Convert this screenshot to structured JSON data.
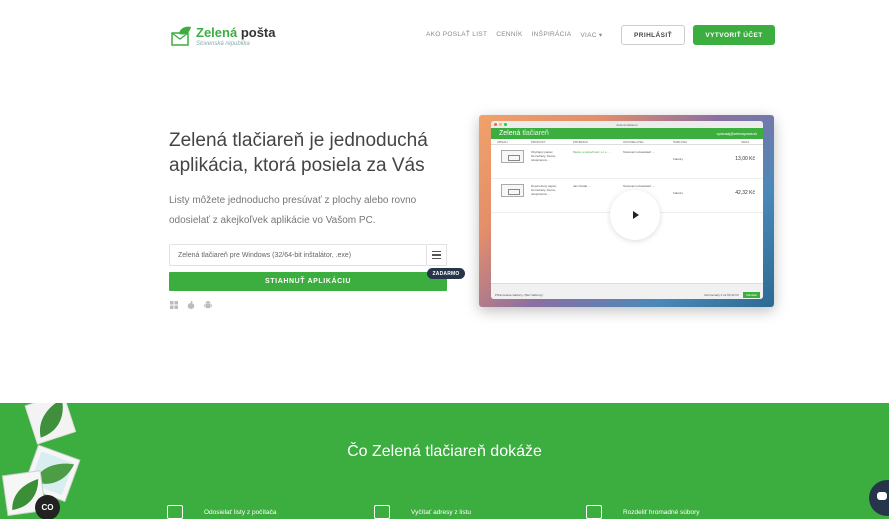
{
  "header": {
    "logo_name_green": "Zelená",
    "logo_name_dark": "pošta",
    "logo_sub": "Slovenská republika",
    "nav": [
      {
        "label": "AKO POSLAŤ LIST"
      },
      {
        "label": "CENNÍK"
      },
      {
        "label": "INŠPIRÁCIA"
      },
      {
        "label": "VIAC ▾"
      }
    ],
    "login_label": "PRIHLÁSIŤ",
    "create_label": "VYTVORIŤ ÚČET"
  },
  "hero": {
    "title": "Zelená tlačiareň je jednoduchá aplikácia, ktorá posiela za Vás",
    "text": "Listy môžete jednoducho presúvať z plochy alebo rovno odosielať z akejkoľvek aplikácie vo Vašom PC.",
    "select_value": "Zelená tlačiareň pre Windows (32/64-bit inštalátor, .exe)",
    "download_label": "STIAHNUŤ APLIKÁCIU",
    "badge": "ZADARMO",
    "os_icons": [
      "windows-icon",
      "apple-icon",
      "android-icon"
    ]
  },
  "app_shot": {
    "window_title": "Zelená tlačiareň",
    "app_name_1": "Zelená",
    "app_name_2": "tlačiareň",
    "account": "vyskusaj@zelenaposta.sk",
    "columns": [
      "OBSAH",
      "PRODUKT",
      "PRÍJEMCA",
      "ODOSIELATEĽ",
      "ŠABLÓNA",
      "CENA"
    ],
    "rows": [
      {
        "product": "Obyčajný papier, čiernobiely, čierna, obojstranná ...",
        "recipient": "Mesto a spoločnosť, s.r.o. ...",
        "sender": "Testovací odosielateľ ...",
        "template": "Faktury",
        "price": "13,00 Kč"
      },
      {
        "product": "Doporučený papier, čiernobiely, čierna, obojstranná ...",
        "recipient": "Jan Novák ...",
        "sender": "Testovací odosielateľ ...",
        "template": "Faktury",
        "price": "42,32 Kč"
      }
    ],
    "footer_left": "Přiřazovanie šablony: (Bez šablony)",
    "footer_total": "Dohromady 2 za 55,32 Kč",
    "pay_label": "Odoslať"
  },
  "features_section": {
    "title": "Čo Zelená tlačiareň dokáže",
    "items": [
      {
        "label": "Odosielať listy z počítača",
        "icon": "monitor-icon"
      },
      {
        "label": "Vyčítať adresy z listu",
        "icon": "document-list-icon"
      },
      {
        "label": "Rozdeliť hromadné súbory",
        "icon": "split-file-icon"
      }
    ]
  },
  "widgets": {
    "cookie_label": "CO"
  },
  "colors": {
    "brand_green": "#3cae3f",
    "dark_navy": "#26354a"
  }
}
